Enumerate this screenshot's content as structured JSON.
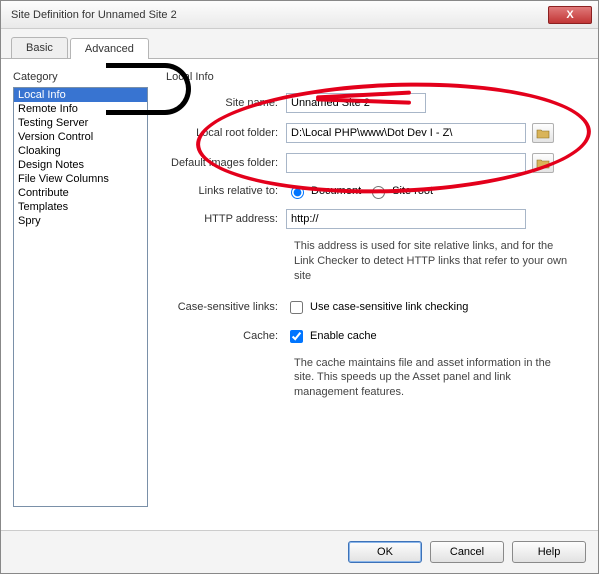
{
  "window": {
    "title": "Site Definition for Unnamed Site 2",
    "close": "X"
  },
  "tabs": {
    "basic": "Basic",
    "advanced": "Advanced"
  },
  "category": {
    "header": "Category",
    "items": [
      "Local Info",
      "Remote Info",
      "Testing Server",
      "Version Control",
      "Cloaking",
      "Design Notes",
      "File View Columns",
      "Contribute",
      "Templates",
      "Spry"
    ]
  },
  "panel": {
    "title": "Local Info",
    "site_name_label": "Site name:",
    "site_name_value": "Unnamed Site 2",
    "local_root_label": "Local root folder:",
    "local_root_value": "D:\\Local PHP\\www\\Dot Dev I - Z\\",
    "default_images_label": "Default images folder:",
    "default_images_value": "",
    "links_label": "Links relative to:",
    "links_opt_doc": "Document",
    "links_opt_site": "Site root",
    "http_label": "HTTP address:",
    "http_value": "http://",
    "http_hint": "This address is used for site relative links, and for the Link Checker to detect HTTP links that refer to your own site",
    "case_label": "Case-sensitive links:",
    "case_check": "Use case-sensitive link checking",
    "cache_label": "Cache:",
    "cache_check": "Enable cache",
    "cache_hint": "The cache maintains file and asset information in the site.  This speeds up the Asset panel and link management features."
  },
  "buttons": {
    "ok": "OK",
    "cancel": "Cancel",
    "help": "Help"
  }
}
